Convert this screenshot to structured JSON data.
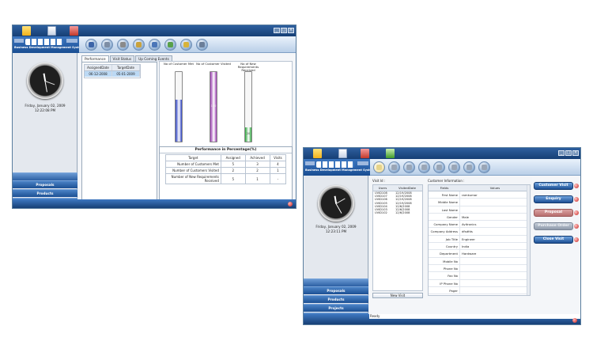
{
  "window1": {
    "brand_name": "Business Development Management System",
    "clock": {
      "date": "Friday, January 02, 2009",
      "time": "12:22:08 PM"
    },
    "nav": [
      "Proposals",
      "Products",
      "Projects"
    ],
    "tabs": [
      "Performance",
      "Visit Status",
      "Up Coming Events"
    ],
    "assign_table": {
      "headers": [
        "AssignedDate",
        "TargetDate"
      ],
      "rows": [
        [
          "06-12-2008",
          "05-01-2009"
        ]
      ]
    },
    "bar_labels": [
      "No of Customer Met",
      "No of Customer Visited",
      "No of New Requirements Received"
    ],
    "bar_values": [
      "",
      "100",
      "20"
    ],
    "bar_fill_fractions": [
      0.6,
      1.0,
      0.2
    ],
    "bar_colors": [
      "#2a3fc1",
      "#9a3bb0",
      "#2aa43a"
    ],
    "perf_title": "Performance in Percentage(%)",
    "perf_headers": [
      "Target",
      "Assigned",
      "Achieved",
      "Visits"
    ],
    "perf_rows": [
      [
        "Number of Customers Met",
        "5",
        "3",
        "4"
      ],
      [
        "Number of Customers Visited",
        "2",
        "2",
        "1"
      ],
      [
        "Number of New Requirements Received",
        "5",
        "1",
        "-"
      ]
    ]
  },
  "window2": {
    "brand_name": "Business Development Management System",
    "clock": {
      "date": "Friday, January 02, 2009",
      "time": "12:23:11 PM"
    },
    "nav": [
      "Proposals",
      "Products",
      "Projects",
      "About Us"
    ],
    "visit_title": "Visit Id :",
    "users_headers": [
      "Users",
      "VisitedDate"
    ],
    "users_rows": [
      [
        "UVID108",
        "12/19/2008"
      ],
      [
        "UVID107",
        "12/19/2008"
      ],
      [
        "UVID106",
        "12/19/2008"
      ],
      [
        "UVID105",
        "12/19/2008"
      ],
      [
        "UVID104",
        "12/6/2008"
      ],
      [
        "UVID103",
        "12/6/2008"
      ],
      [
        "UVID102",
        "12/6/2008"
      ]
    ],
    "new_visit": "New Visit",
    "customer_title": "Customer Information :",
    "customer_headers": [
      "Fields",
      "Values"
    ],
    "customer_rows": [
      [
        "First Name",
        "ramkumar"
      ],
      [
        "Middle Name",
        ""
      ],
      [
        "Last Name",
        ""
      ],
      [
        "Gender",
        "Male"
      ],
      [
        "Company Name",
        "Avitronics"
      ],
      [
        "Company Address",
        "dfsdfds"
      ],
      [
        "Job Title",
        "Engineer"
      ],
      [
        "Country",
        "India"
      ],
      [
        "Department",
        "Hardware"
      ],
      [
        "Mobile No",
        ""
      ],
      [
        "Phone No",
        ""
      ],
      [
        "Fax No",
        ""
      ],
      [
        "IP Phone No",
        ""
      ],
      [
        "Pager",
        ""
      ]
    ],
    "actions": [
      "Customer Visit",
      "Enquiry",
      "Proposal",
      "Purchase Order",
      "Close Visit"
    ],
    "status": "Ready"
  }
}
